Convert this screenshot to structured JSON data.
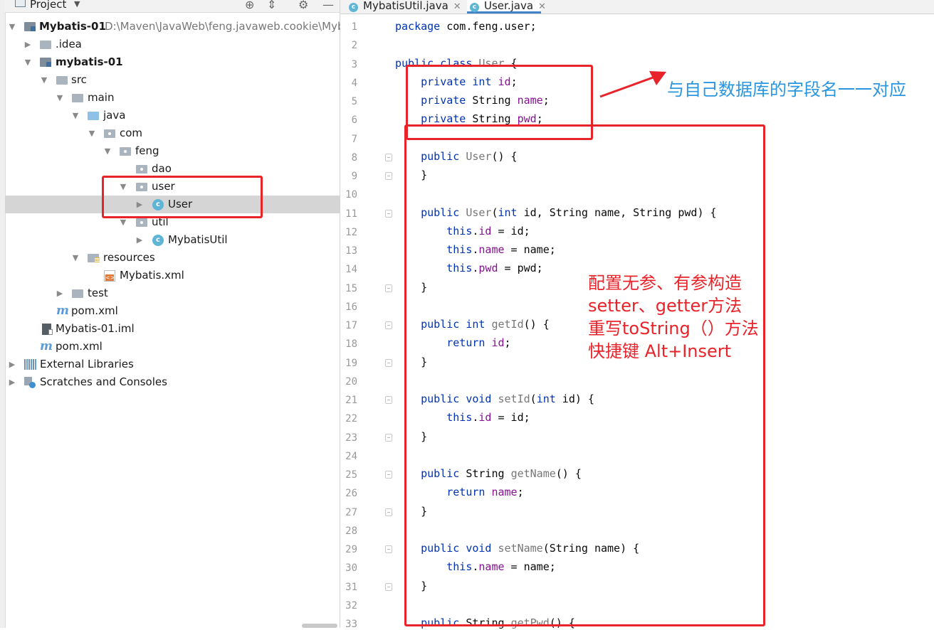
{
  "project_panel": {
    "title": "Project",
    "tree": [
      {
        "label": "Mybatis-01",
        "path": "D:\\Maven\\JavaWeb\\feng.javaweb.cookie\\Myb",
        "icon": "module-icon",
        "bold": true
      },
      {
        "label": ".idea",
        "icon": "folder-icon"
      },
      {
        "label": "mybatis-01",
        "icon": "module-icon",
        "bold": true
      },
      {
        "label": "src",
        "icon": "folder-icon"
      },
      {
        "label": "main",
        "icon": "folder-icon"
      },
      {
        "label": "java",
        "icon": "source-folder-icon"
      },
      {
        "label": "com",
        "icon": "package-icon"
      },
      {
        "label": "feng",
        "icon": "package-icon"
      },
      {
        "label": "dao",
        "icon": "package-icon"
      },
      {
        "label": "user",
        "icon": "package-icon"
      },
      {
        "label": "User",
        "icon": "class-icon",
        "selected": true
      },
      {
        "label": "util",
        "icon": "package-icon"
      },
      {
        "label": "MybatisUtil",
        "icon": "class-icon"
      },
      {
        "label": "resources",
        "icon": "resources-folder-icon"
      },
      {
        "label": "Mybatis.xml",
        "icon": "xml-file-icon"
      },
      {
        "label": "test",
        "icon": "folder-icon"
      },
      {
        "label": "pom.xml",
        "icon": "maven-icon"
      },
      {
        "label": "Mybatis-01.iml",
        "icon": "iml-file-icon"
      },
      {
        "label": "pom.xml",
        "icon": "maven-icon"
      },
      {
        "label": "External Libraries",
        "icon": "library-icon"
      },
      {
        "label": "Scratches and Consoles",
        "icon": "scratches-icon"
      }
    ]
  },
  "editor": {
    "tabs": [
      {
        "label": "MybatisUtil.java",
        "icon": "class-icon",
        "active": false
      },
      {
        "label": "User.java",
        "icon": "class-icon",
        "active": true
      }
    ],
    "line_numbers": [
      "1",
      "2",
      "3",
      "4",
      "5",
      "6",
      "7",
      "8",
      "9",
      "10",
      "11",
      "12",
      "13",
      "14",
      "15",
      "16",
      "17",
      "18",
      "19",
      "20",
      "21",
      "22",
      "23",
      "24",
      "25",
      "26",
      "27",
      "28",
      "29",
      "30",
      "31",
      "32",
      "33"
    ]
  },
  "annotations": {
    "fields_note": "与自己数据库的字段名一一对应",
    "methods_note": [
      "配置无参、有参构造",
      "setter、getter方法",
      "重写toString（）方法",
      "快捷键 Alt+Insert"
    ],
    "accent_red": "#e8232a",
    "accent_blue": "#2b96e0"
  }
}
